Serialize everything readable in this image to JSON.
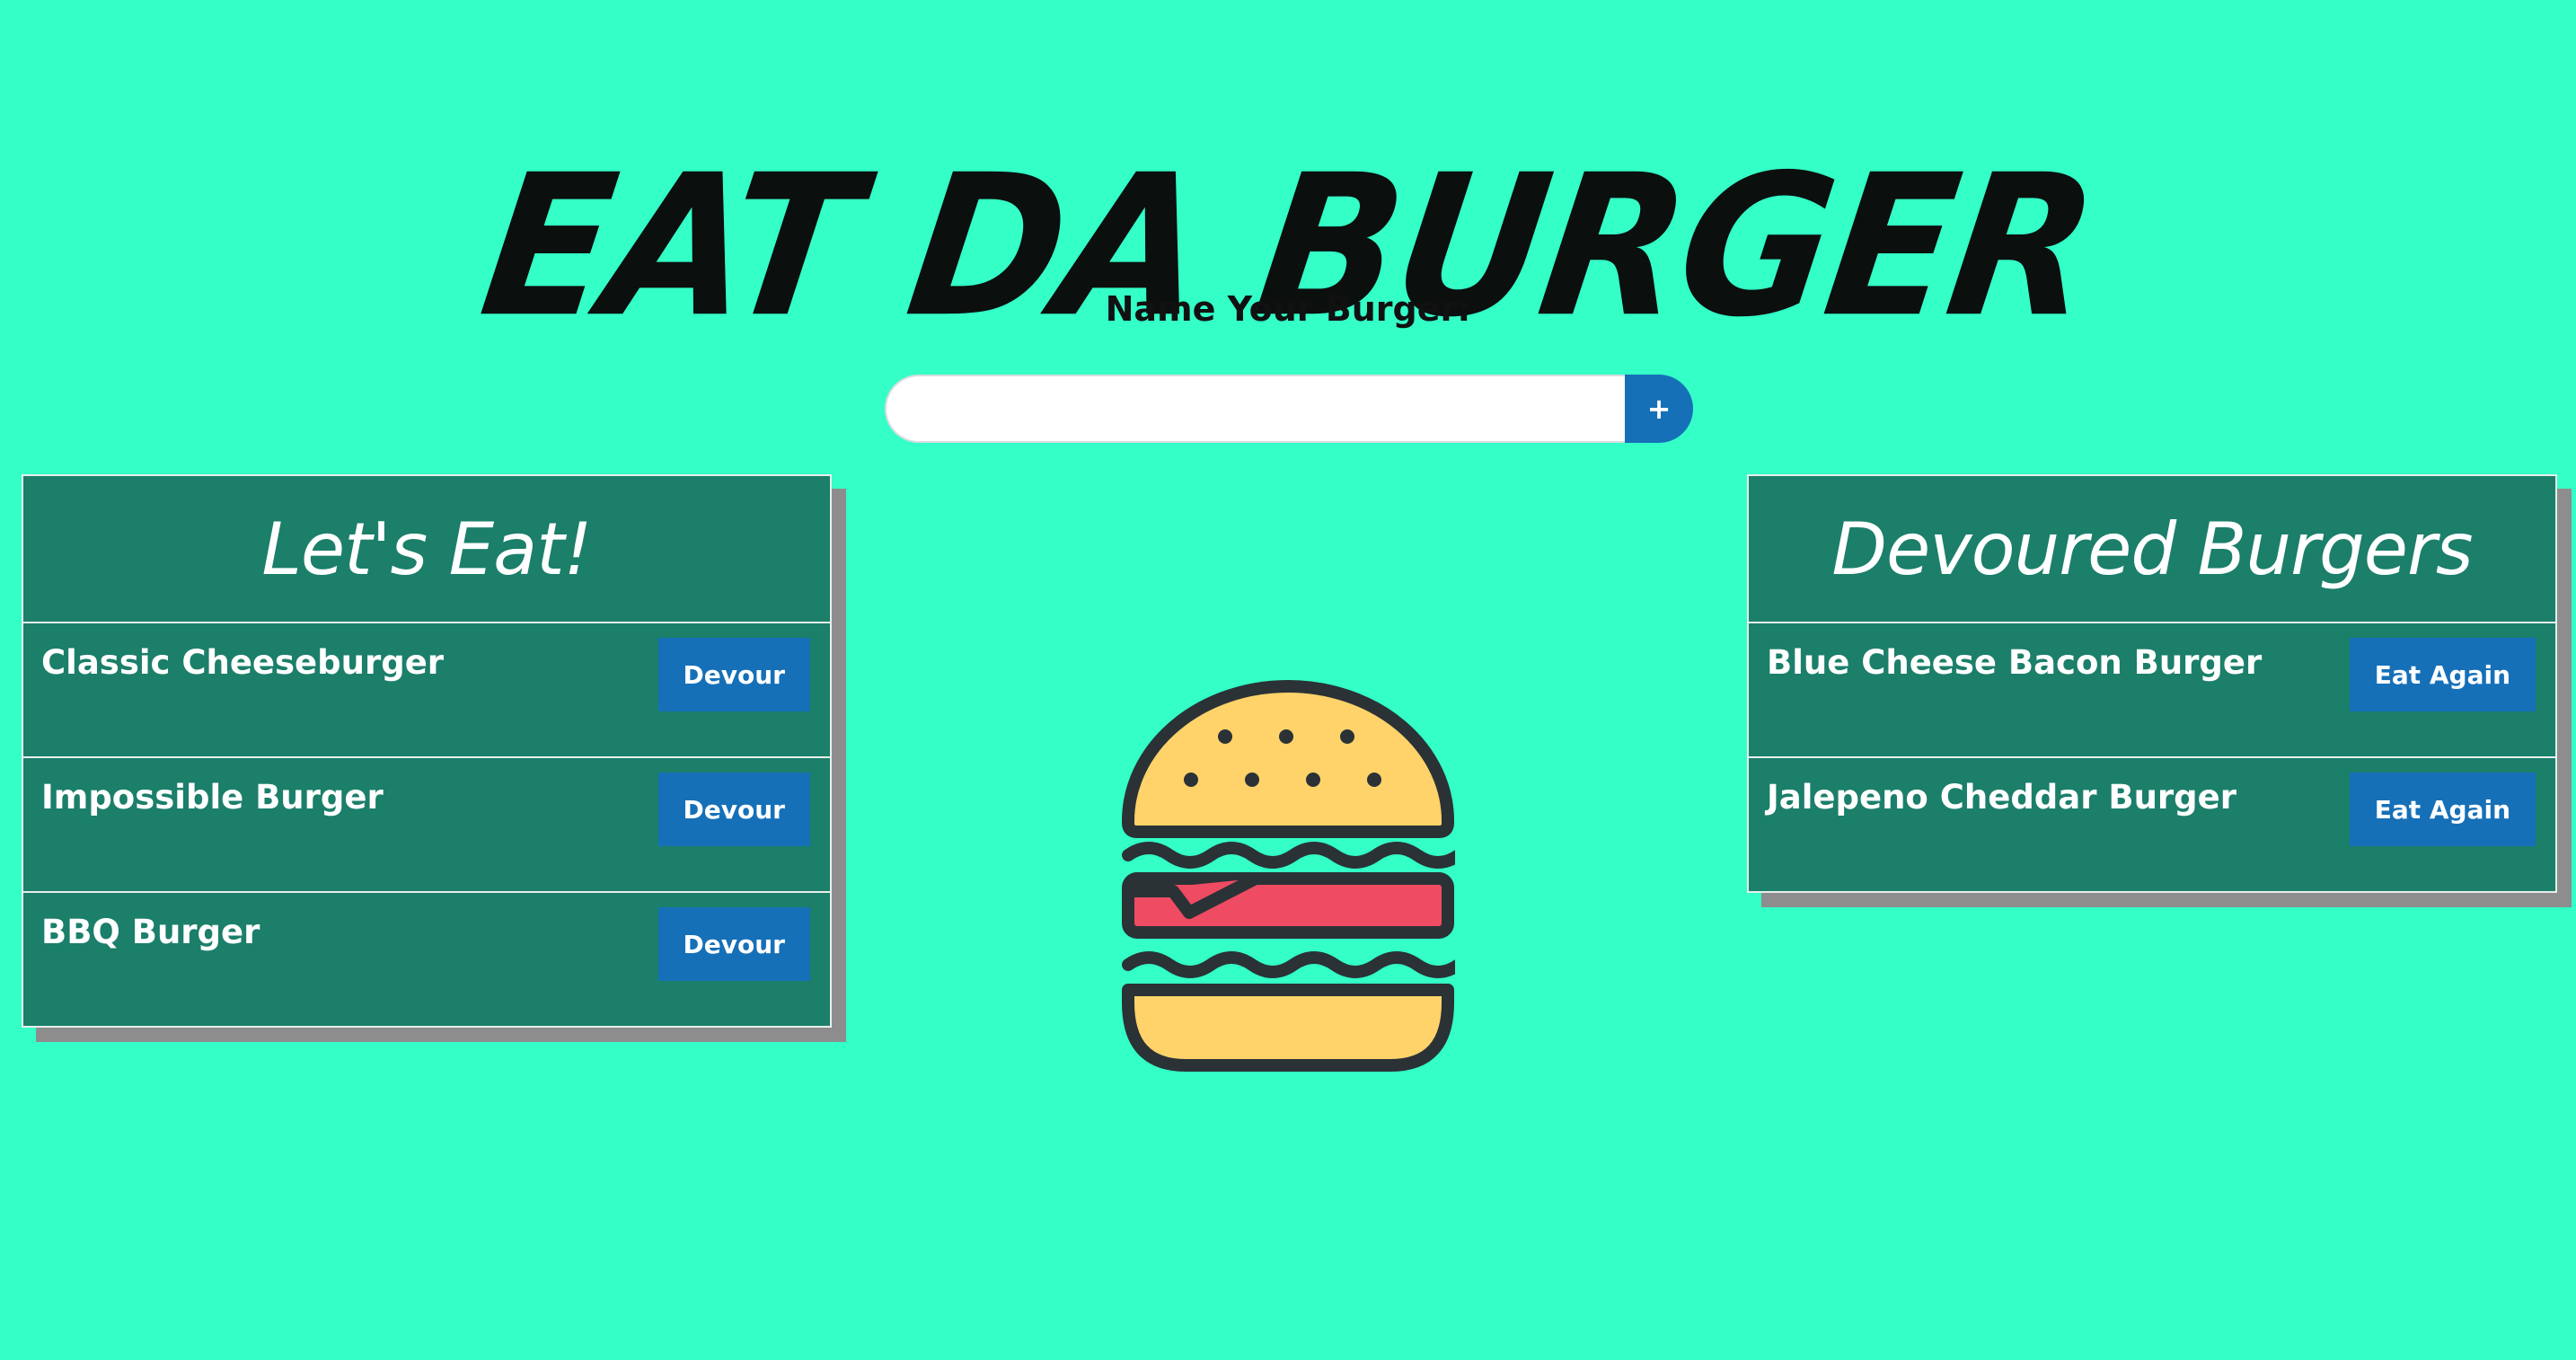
{
  "header": {
    "title": "Eat Da Burger"
  },
  "form": {
    "label": "Name Your Burger:",
    "input_value": "",
    "input_placeholder": "",
    "submit_label": "+"
  },
  "lets_eat": {
    "title": "Let's Eat!",
    "items": [
      {
        "name": "Classic Cheeseburger",
        "button": "Devour"
      },
      {
        "name": "Impossible Burger",
        "button": "Devour"
      },
      {
        "name": "BBQ Burger",
        "button": "Devour"
      }
    ]
  },
  "devoured": {
    "title": "Devoured Burgers",
    "items": [
      {
        "name": "Blue Cheese Bacon Burger",
        "button": "Eat Again"
      },
      {
        "name": "Jalepeno Cheddar Burger",
        "button": "Eat Again"
      }
    ]
  },
  "illustration": {
    "icon": "burger-icon"
  },
  "colors": {
    "background": "#33ffc7",
    "panel": "#1b7f6a",
    "button": "#1670b8",
    "bun": "#ffd36a",
    "patty": "#ef4b63",
    "outline": "#2a3236"
  }
}
